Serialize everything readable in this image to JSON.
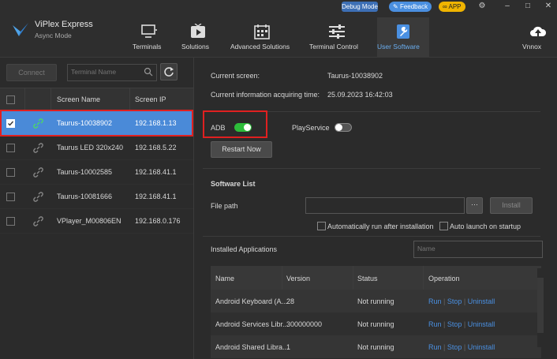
{
  "app": {
    "title": "ViPlex Express",
    "subtitle": "Async Mode"
  },
  "topbar": {
    "debug_label": "Debug Mode",
    "feedback_label": "Feedback",
    "app_label": "APP"
  },
  "nav": {
    "items": [
      {
        "label": "Terminals",
        "icon": "monitor-icon"
      },
      {
        "label": "Solutions",
        "icon": "play-icon"
      },
      {
        "label": "Advanced Solutions",
        "icon": "calendar-icon"
      },
      {
        "label": "Terminal Control",
        "icon": "sliders-icon"
      },
      {
        "label": "User Software",
        "icon": "wrench-icon"
      },
      {
        "label": "Vnnox",
        "icon": "cloud-upload-icon"
      }
    ],
    "active_index": 4
  },
  "left": {
    "connect_label": "Connect",
    "search_placeholder": "Terminal Name",
    "columns": {
      "name": "Screen Name",
      "ip": "Screen IP"
    },
    "devices": [
      {
        "name": "Taurus-10038902",
        "ip": "192.168.1.13",
        "checked": true,
        "selected": true
      },
      {
        "name": "Taurus LED 320x240",
        "ip": "192.168.5.22",
        "checked": false,
        "selected": false
      },
      {
        "name": "Taurus-10002585",
        "ip": "192.168.41.1",
        "checked": false,
        "selected": false
      },
      {
        "name": "Taurus-10081666",
        "ip": "192.168.41.1",
        "checked": false,
        "selected": false
      },
      {
        "name": "VPlayer_M00806EN",
        "ip": "192.168.0.176",
        "checked": false,
        "selected": false
      }
    ]
  },
  "info": {
    "current_screen_label": "Current screen:",
    "current_screen_value": "Taurus-10038902",
    "acquire_time_label": "Current information acquiring time:",
    "acquire_time_value": "25.09.2023 16:42:03"
  },
  "toggles": {
    "adb_label": "ADB",
    "adb_on": true,
    "playservice_label": "PlayService",
    "playservice_on": false,
    "restart_label": "Restart Now"
  },
  "software": {
    "section_title": "Software List",
    "file_path_label": "File path",
    "file_path_value": "",
    "browse_label": "···",
    "install_label": "Install",
    "auto_run_label": "Automatically run after installation",
    "auto_launch_label": "Auto launch on startup"
  },
  "installed": {
    "title": "Installed Applications",
    "search_placeholder": "Name",
    "columns": {
      "name": "Name",
      "version": "Version",
      "status": "Status",
      "operation": "Operation"
    },
    "apps": [
      {
        "name": "Android Keyboard (A...",
        "version": "28",
        "status": "Not running"
      },
      {
        "name": "Android Services Libr...",
        "version": "300000000",
        "status": "Not running"
      },
      {
        "name": "Android Shared Libra...",
        "version": "1",
        "status": "Not running"
      }
    ],
    "ops": {
      "run": "Run",
      "stop": "Stop",
      "uninstall": "Uninstall",
      "sep": "|"
    }
  },
  "colors": {
    "accent": "#4a8ad8",
    "toggle_on": "#2dbd3a",
    "highlight": "#e02020",
    "link": "#4a90e2"
  }
}
